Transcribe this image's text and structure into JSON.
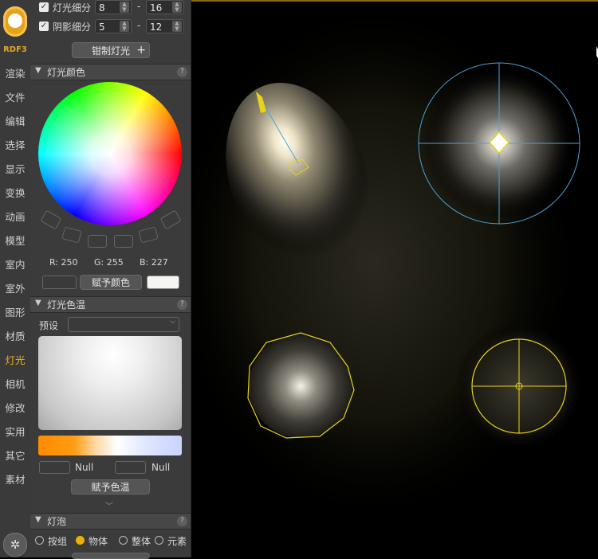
{
  "nav": {
    "brand": "RDF3",
    "items": [
      "渲染",
      "文件",
      "编辑",
      "选择",
      "显示",
      "变换",
      "动画",
      "模型",
      "室内",
      "室外",
      "图形",
      "材质",
      "灯光",
      "相机",
      "修改",
      "实用",
      "其它",
      "素材"
    ],
    "active_index": 12
  },
  "subdivision": {
    "light_label": "灯光细分",
    "light_min": "8",
    "light_max": "16",
    "shadow_label": "阴影细分",
    "shadow_min": "5",
    "shadow_max": "12",
    "separator": "-",
    "light_checked": true,
    "shadow_checked": true,
    "make_light_label": "钳制灯光",
    "plus": "+"
  },
  "color_section": {
    "title": "灯光颜色",
    "help": "?",
    "r_label": "R: 250",
    "g_label": "G: 255",
    "b_label": "B: 227",
    "assign_label": "赋予颜色"
  },
  "temp_section": {
    "title": "灯光色温",
    "help": "?",
    "preset_label": "预设",
    "preset_value": "",
    "null_left": "Null",
    "null_right": "Null",
    "assign_label": "赋予色温"
  },
  "bulb_section": {
    "title": "灯泡",
    "help": "?",
    "options": [
      "按组",
      "物体",
      "整体",
      "元素"
    ],
    "selected_index": 1
  },
  "colors": {
    "accent": "#f0b21c",
    "selection_yellow": "#e8d21a",
    "viewport_blue": "#4aa3d8",
    "panel_bg": "#3b3b3b"
  },
  "icons": {
    "logo": "bear-logo-icon",
    "settings": "gear-icon"
  }
}
